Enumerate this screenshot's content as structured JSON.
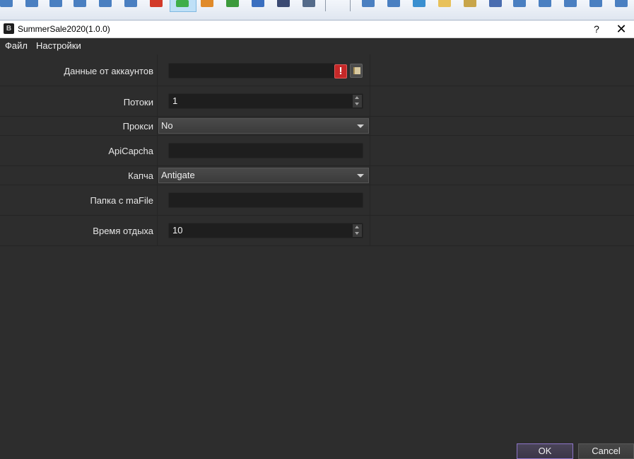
{
  "window": {
    "title": "SummerSale2020(1.0.0)",
    "help_label": "?",
    "close_label": "✕"
  },
  "menu": {
    "items": [
      "Файл",
      "Настройки"
    ]
  },
  "form": {
    "accounts": {
      "label": "Данные от аккаунтов",
      "value": ""
    },
    "threads": {
      "label": "Потоки",
      "value": "1"
    },
    "proxy": {
      "label": "Прокси",
      "value": "No"
    },
    "apicapcha": {
      "label": "ApiCapcha",
      "value": ""
    },
    "captcha": {
      "label": "Капча",
      "value": "Antigate"
    },
    "mafile_folder": {
      "label": "Папка с maFile",
      "value": ""
    },
    "rest_time": {
      "label": "Время отдыха",
      "value": "10"
    },
    "error_icon_glyph": "!"
  },
  "buttons": {
    "ok": "OK",
    "cancel": "Cancel"
  },
  "colors": {
    "background": "#2d2d2d",
    "field": "#1e1e1e",
    "error": "#c62828",
    "ok_border": "#8c74c8"
  }
}
